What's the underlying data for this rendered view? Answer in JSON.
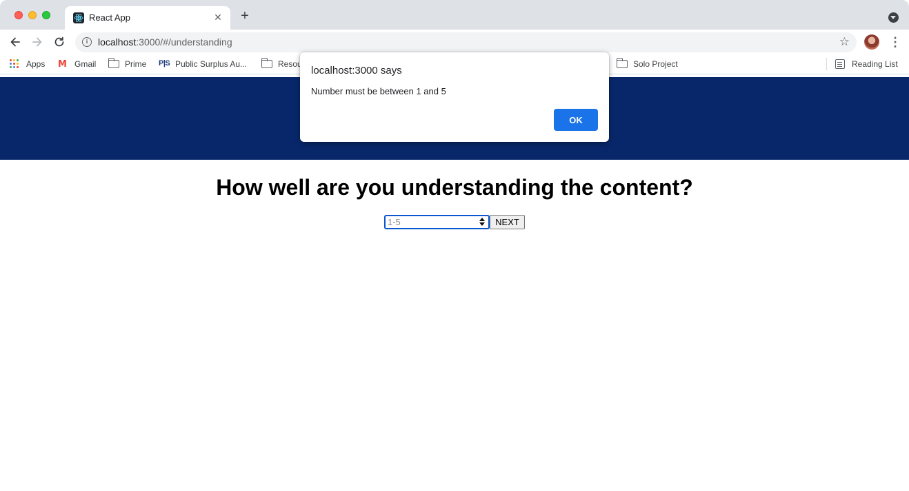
{
  "browser": {
    "tab": {
      "title": "React App",
      "close_glyph": "✕",
      "favicon": "react-icon"
    },
    "new_tab_glyph": "+",
    "address": {
      "host": "localhost",
      "rest": ":3000/#/understanding"
    },
    "star_glyph": "☆",
    "menu_glyph": "⋮"
  },
  "bookmarks": {
    "items": [
      {
        "label": "Apps",
        "icon": "apps-icon"
      },
      {
        "label": "Gmail",
        "icon": "gmail-icon"
      },
      {
        "label": "Prime",
        "icon": "folder-icon"
      },
      {
        "label": "Public Surplus Au...",
        "icon": "public-surplus-icon"
      },
      {
        "label": "Resou",
        "icon": "folder-icon"
      },
      {
        "label": "Solo Project",
        "icon": "folder-icon"
      }
    ],
    "reading_list": "Reading List",
    "gmail_glyph": "M",
    "ps_glyph": "P|S"
  },
  "page": {
    "question": "How well are you understanding the content?",
    "input_placeholder": "1-5",
    "next_label": "NEXT",
    "banner_color": "#08276a"
  },
  "dialog": {
    "title": "localhost:3000 says",
    "message": "Number must be between 1 and 5",
    "ok_label": "OK"
  }
}
